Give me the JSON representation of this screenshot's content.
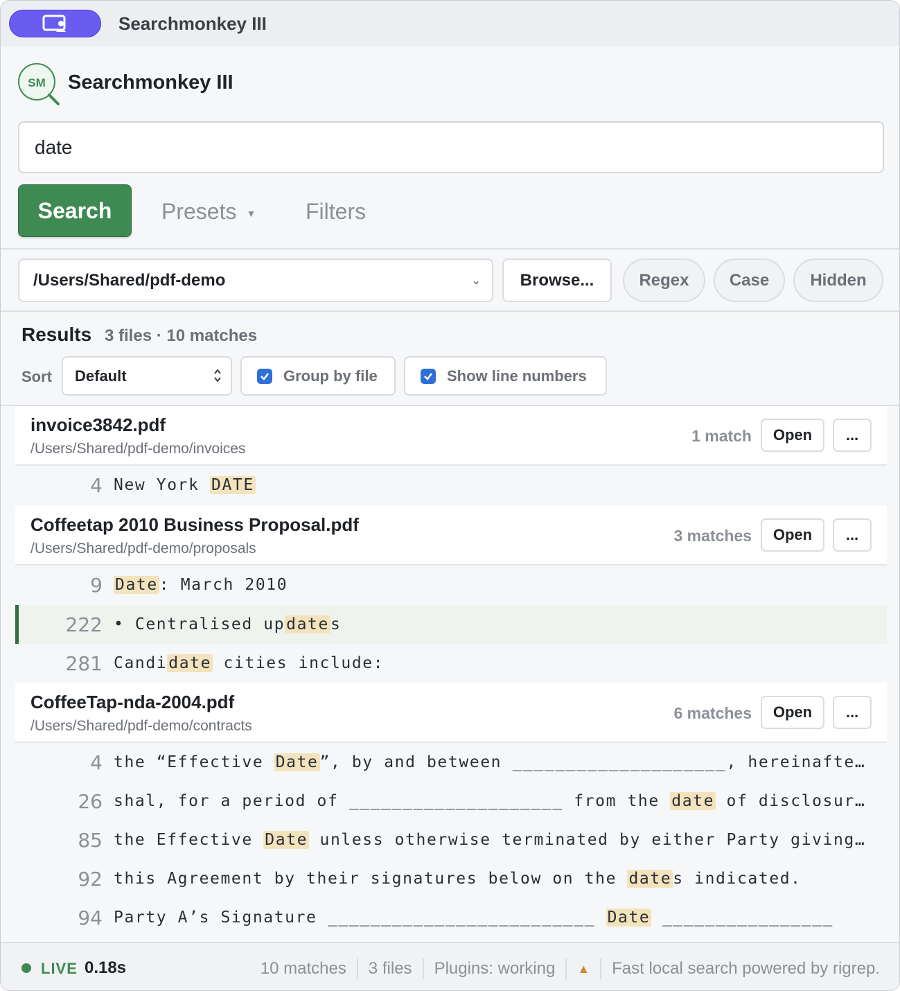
{
  "window": {
    "title": "Searchmonkey III"
  },
  "brand": {
    "logo_text": "SM",
    "name": "Searchmonkey III"
  },
  "search": {
    "value": "date",
    "button_label": "Search",
    "presets_label": "Presets",
    "filters_label": "Filters"
  },
  "path": {
    "value": "/Users/Shared/pdf-demo",
    "browse_label": "Browse...",
    "chips": [
      "Regex",
      "Case",
      "Hidden"
    ]
  },
  "results": {
    "title": "Results",
    "summary": "3 files · 10 matches",
    "sort_label": "Sort",
    "sort_value": "Default",
    "group_by_file": "Group by file",
    "show_line_numbers": "Show line numbers",
    "open_label": "Open",
    "more_label": "...",
    "files": [
      {
        "name": "invoice3842.pdf",
        "path": "/Users/Shared/pdf-demo/invoices",
        "count": "1 match",
        "lines": [
          {
            "no": "4",
            "pre": "New York ",
            "hit": "DATE",
            "post": ""
          }
        ]
      },
      {
        "name": "Coffeetap 2010 Business Proposal.pdf",
        "path": "/Users/Shared/pdf-demo/proposals",
        "count": "3 matches",
        "lines": [
          {
            "no": "9",
            "pre": "",
            "hit": "Date",
            "post": ": March 2010"
          },
          {
            "no": "222",
            "pre": "• Centralised up",
            "hit": "date",
            "post": "s"
          },
          {
            "no": "281",
            "pre": "Candi",
            "hit": "date",
            "post": " cities include:"
          }
        ]
      },
      {
        "name": "CoffeeTap-nda-2004.pdf",
        "path": "/Users/Shared/pdf-demo/contracts",
        "count": "6 matches",
        "lines": [
          {
            "no": "4",
            "pre": "the “Effective ",
            "hit": "Date",
            "post": "”, by and between ____________________, hereinafter …"
          },
          {
            "no": "26",
            "pre": "shal, for a period of ____________________ from the ",
            "hit": "date",
            "post": " of disclosure,…"
          },
          {
            "no": "85",
            "pre": "the Effective ",
            "hit": "Date",
            "post": " unless otherwise terminated by either Party giving no…"
          },
          {
            "no": "92",
            "pre": "this Agreement by their signatures below on the ",
            "hit": "date",
            "post": "s indicated."
          },
          {
            "no": "94",
            "pre": "Party A’s Signature _________________________ ",
            "hit": "Date",
            "post": " ________________"
          }
        ]
      }
    ]
  },
  "status": {
    "live_label": "LIVE",
    "time": "0.18s",
    "matches": "10 matches",
    "files": "3 files",
    "plugins": "Plugins: working",
    "tagline": "Fast local search powered by rigrep."
  },
  "colors": {
    "accent": "#3e8a52",
    "pill": "#6a5cf0",
    "highlight": "#f3e3bc",
    "checkbox": "#2f6fd8"
  }
}
